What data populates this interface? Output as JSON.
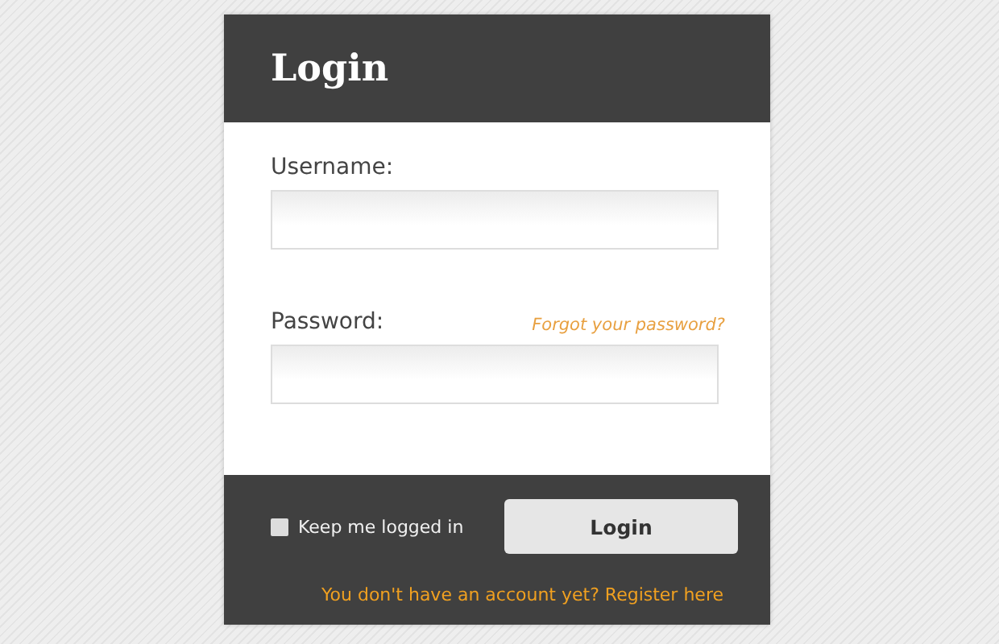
{
  "title": "Login",
  "fields": [
    {
      "label": "Username:"
    },
    {
      "label": "Password:",
      "link": "Forgot your password?"
    }
  ],
  "remember": {
    "label": "Keep me logged in",
    "checked": false
  },
  "submit": "Login",
  "register_link": "You don't have an account yet? Register here"
}
